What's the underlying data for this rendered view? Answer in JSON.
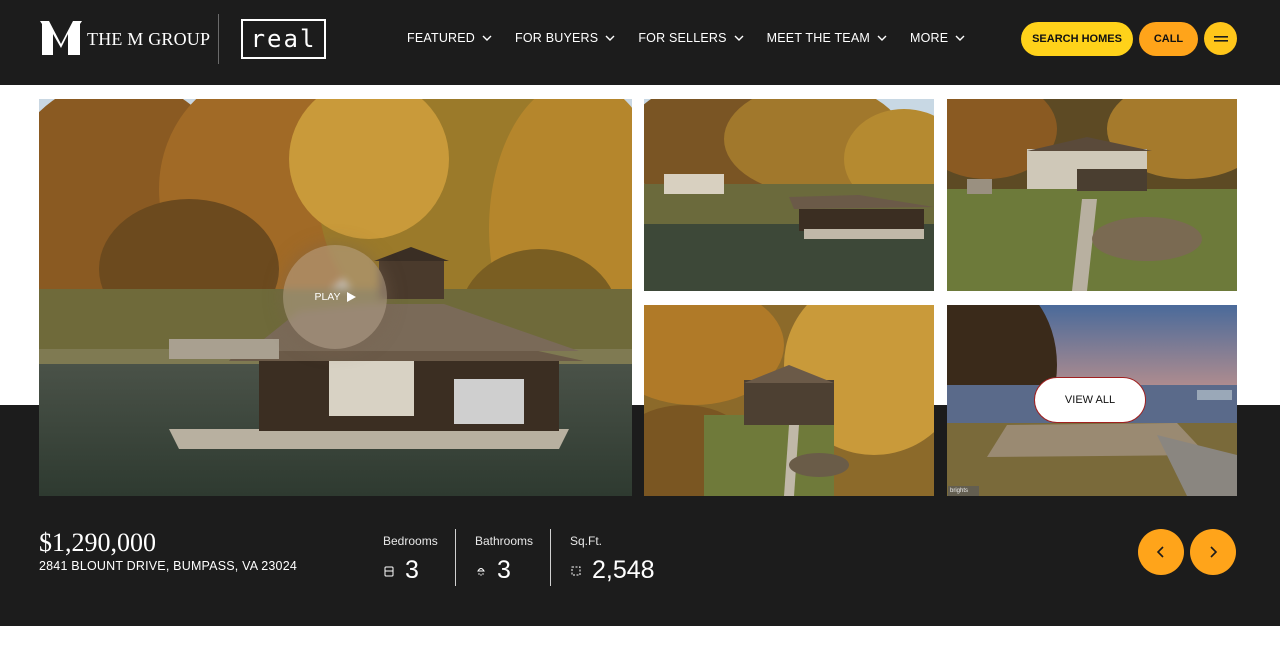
{
  "header": {
    "brand_text": "THE M GROUP",
    "partner_logo": "real",
    "nav": [
      {
        "label": "FEATURED"
      },
      {
        "label": "FOR BUYERS"
      },
      {
        "label": "FOR SELLERS"
      },
      {
        "label": "MEET THE TEAM"
      },
      {
        "label": "MORE"
      }
    ],
    "search_label": "SEARCH HOMES",
    "call_label": "CALL",
    "menu_icon": "hamburger-icon"
  },
  "gallery": {
    "play_label": "PLAY",
    "view_all_label": "VIEW ALL",
    "watermark": "brights"
  },
  "listing": {
    "price": "$1,290,000",
    "address": "2841 BLOUNT DRIVE, BUMPASS, VA 23024",
    "stats": [
      {
        "label": "Bedrooms",
        "value": "3",
        "icon": "bed-icon"
      },
      {
        "label": "Bathrooms",
        "value": "3",
        "icon": "shower-icon"
      },
      {
        "label": "Sq.Ft.",
        "value": "2,548",
        "icon": "area-icon"
      }
    ]
  },
  "colors": {
    "header_bg": "#1c1c1c",
    "search_btn": "#ffd21a",
    "call_btn": "#ffa41a",
    "arrow_btn": "#ffa41a"
  }
}
